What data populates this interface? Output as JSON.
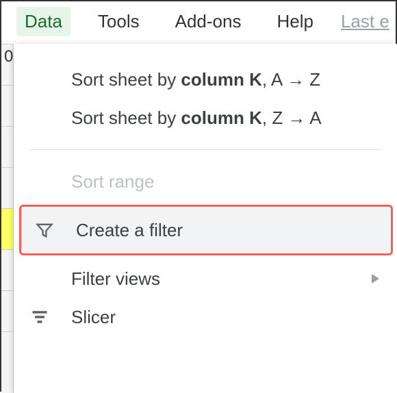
{
  "menubar": {
    "data": "Data",
    "tools": "Tools",
    "addons": "Add-ons",
    "help": "Help",
    "last_edit": "Last e"
  },
  "dropdown": {
    "sort_az_prefix": "Sort sheet by ",
    "sort_az_col": "column K",
    "sort_az_suffix": ", A → Z",
    "sort_za_prefix": "Sort sheet by ",
    "sort_za_col": "column K",
    "sort_za_suffix": ", Z → A",
    "sort_range": "Sort range",
    "create_filter": "Create a filter",
    "filter_views": "Filter views",
    "slicer": "Slicer"
  },
  "bg": {
    "zero": "0"
  }
}
